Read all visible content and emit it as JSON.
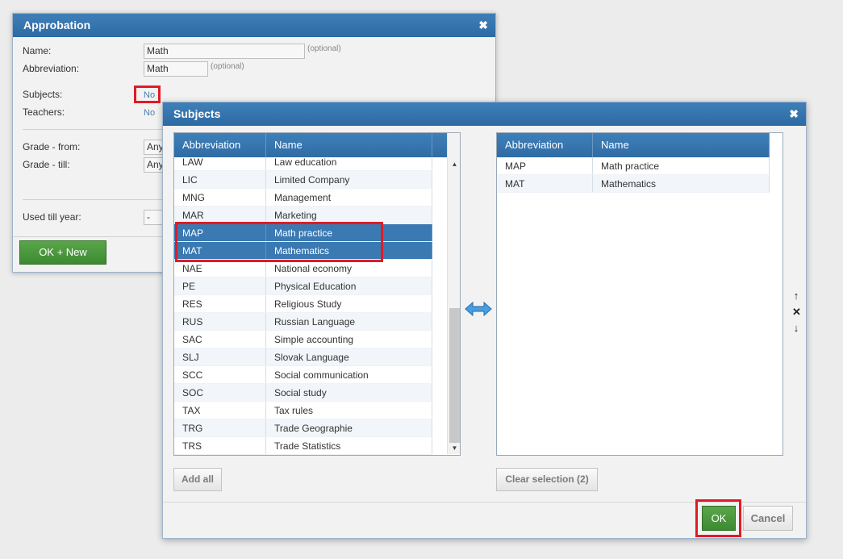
{
  "approbation": {
    "title": "Approbation",
    "close_glyph": "✖",
    "name_label": "Name:",
    "name_value": "Math",
    "optional_hint": "(optional)",
    "abbrev_label": "Abbreviation:",
    "abbrev_value": "Math",
    "subjects_label": "Subjects:",
    "subjects_value": "No",
    "teachers_label": "Teachers:",
    "teachers_value": "No",
    "grade_from_label": "Grade - from:",
    "grade_from_value": "Any",
    "grade_till_label": "Grade - till:",
    "grade_till_value": "Any",
    "used_till_label": "Used till year:",
    "used_till_value": "-",
    "ok_new_label": "OK + New"
  },
  "subjects": {
    "title": "Subjects",
    "close_glyph": "✖",
    "col_abbrev": "Abbreviation",
    "col_name": "Name",
    "available": [
      {
        "abbr": "LAW",
        "name": "Law education",
        "selected": false
      },
      {
        "abbr": "LIC",
        "name": "Limited Company",
        "selected": false
      },
      {
        "abbr": "MNG",
        "name": "Management",
        "selected": false
      },
      {
        "abbr": "MAR",
        "name": "Marketing",
        "selected": false
      },
      {
        "abbr": "MAP",
        "name": "Math practice",
        "selected": true
      },
      {
        "abbr": "MAT",
        "name": "Mathematics",
        "selected": true
      },
      {
        "abbr": "NAE",
        "name": "National economy",
        "selected": false
      },
      {
        "abbr": "PE",
        "name": "Physical Education",
        "selected": false
      },
      {
        "abbr": "RES",
        "name": "Religious Study",
        "selected": false
      },
      {
        "abbr": "RUS",
        "name": "Russian Language",
        "selected": false
      },
      {
        "abbr": "SAC",
        "name": "Simple accounting",
        "selected": false
      },
      {
        "abbr": "SLJ",
        "name": "Slovak Language",
        "selected": false
      },
      {
        "abbr": "SCC",
        "name": "Social communication",
        "selected": false
      },
      {
        "abbr": "SOC",
        "name": "Social study",
        "selected": false
      },
      {
        "abbr": "TAX",
        "name": "Tax rules",
        "selected": false
      },
      {
        "abbr": "TRG",
        "name": "Trade Geographie",
        "selected": false
      },
      {
        "abbr": "TRS",
        "name": "Trade Statistics",
        "selected": false
      }
    ],
    "chosen": [
      {
        "abbr": "MAP",
        "name": "Math practice"
      },
      {
        "abbr": "MAT",
        "name": "Mathematics"
      }
    ],
    "add_all_label": "Add all",
    "clear_selection_label": "Clear selection (2)",
    "ok_label": "OK",
    "cancel_label": "Cancel",
    "transfer_icon": "⇔",
    "move_up_icon": "↑",
    "remove_icon": "✕",
    "move_down_icon": "↓",
    "scroll_up_icon": "▲",
    "scroll_down_icon": "▼"
  },
  "colors": {
    "header_blue": "#3a79b2",
    "selected_row": "#3a79b2",
    "ok_green": "#4a9a3c",
    "highlight_red": "#e01b24"
  }
}
